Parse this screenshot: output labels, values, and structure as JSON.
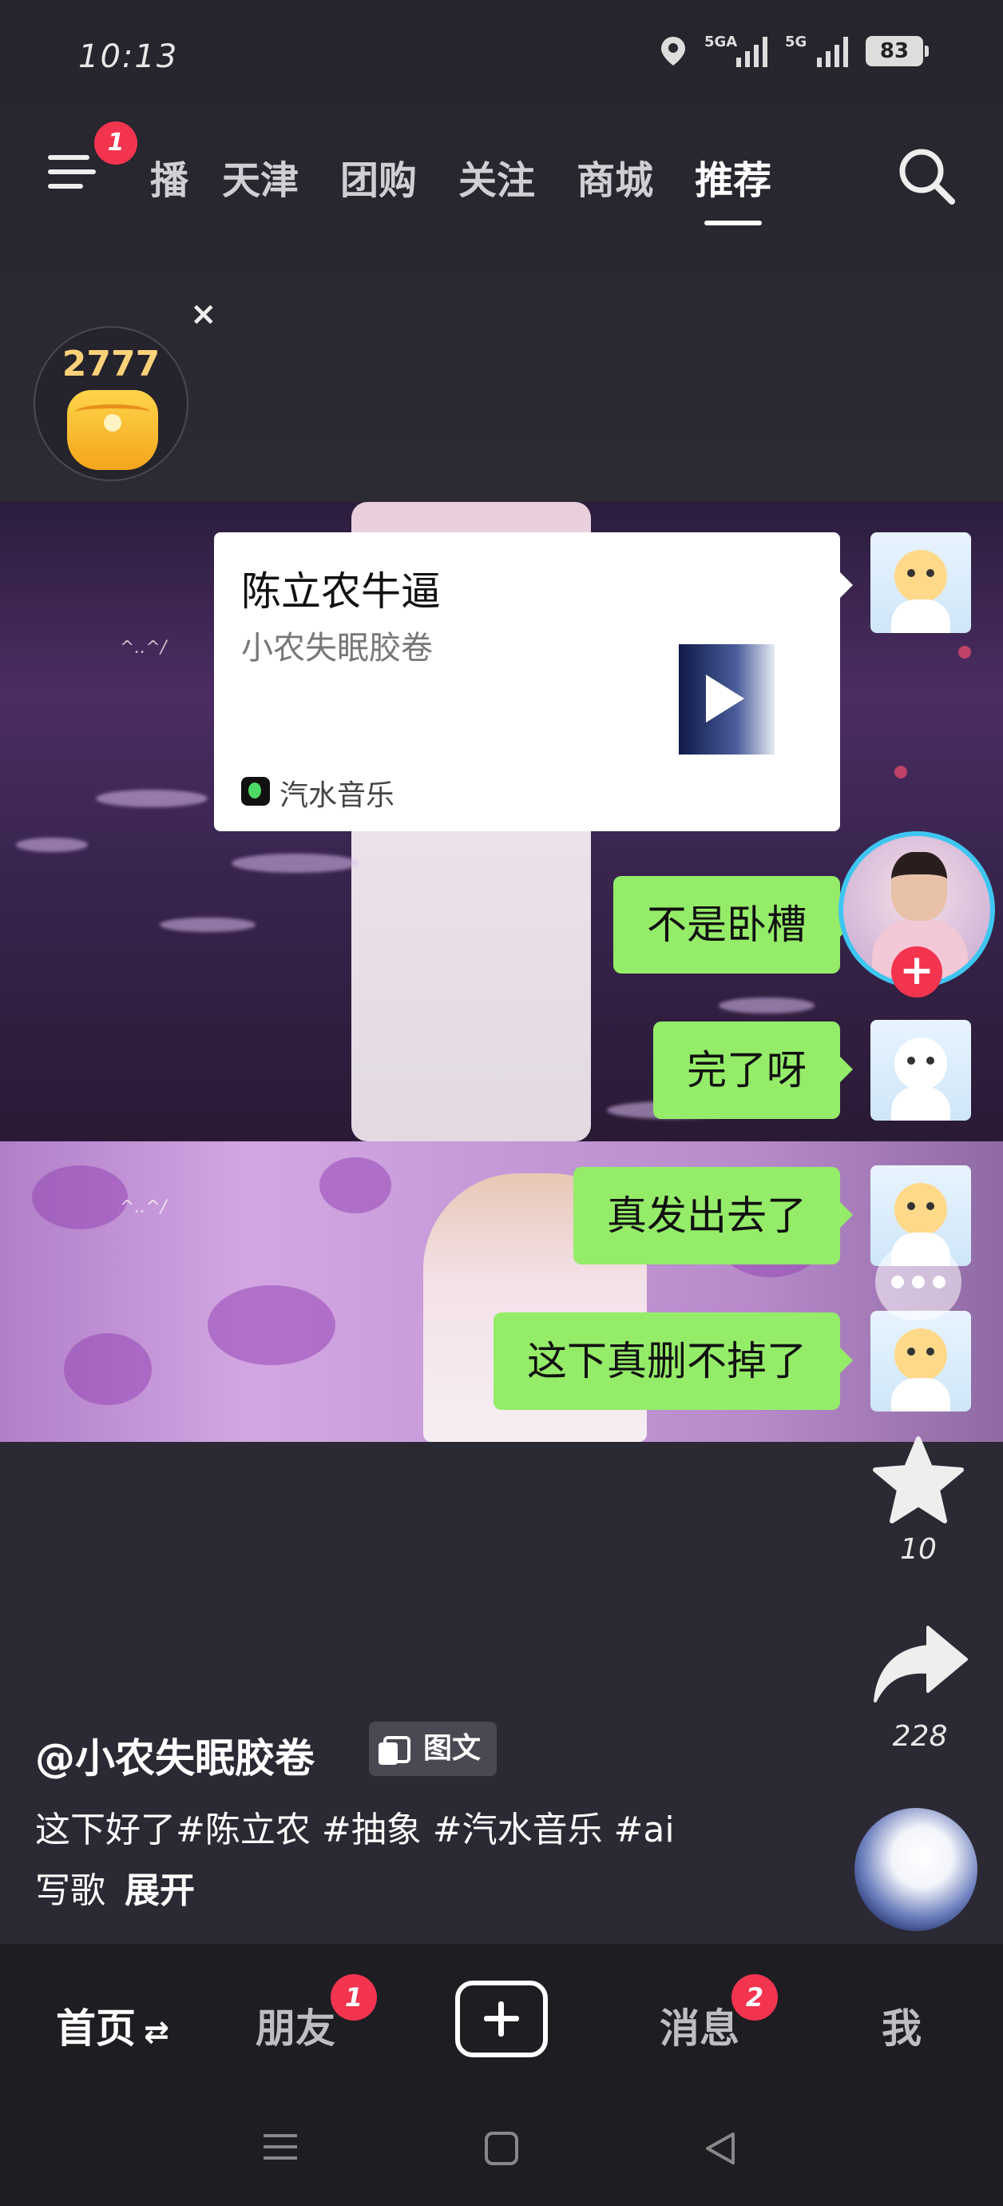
{
  "status_bar": {
    "time": "10:13",
    "signal_1_label": "5GA",
    "signal_2_label": "5G",
    "battery": "83"
  },
  "top_nav": {
    "menu_badge": "1",
    "tabs": [
      {
        "label": "播"
      },
      {
        "label": "天津"
      },
      {
        "label": "团购"
      },
      {
        "label": "关注"
      },
      {
        "label": "商城"
      },
      {
        "label": "推荐"
      }
    ],
    "active_tab": "推荐"
  },
  "coin_widget": {
    "amount": "2777",
    "close_symbol": "×"
  },
  "music_card": {
    "title": "陈立农牛逼",
    "artist": "小农失眠胶卷",
    "app_name": "汽水音乐"
  },
  "chat": {
    "messages": [
      {
        "text": "不是卧槽"
      },
      {
        "text": "完了呀"
      },
      {
        "text": "真发出去了"
      },
      {
        "text": "这下真删不掉了"
      }
    ]
  },
  "right_rail": {
    "favorite_count": "10",
    "share_count": "228"
  },
  "post": {
    "author": "@小农失眠胶卷",
    "type_tag": "图文",
    "caption_line1": "这下好了#陈立农 #抽象 #汽水音乐 #ai",
    "caption_line2": "写歌",
    "expand_label": "展开"
  },
  "bottom_tabs": {
    "home": "首页",
    "home_swap": "⇄",
    "friends": "朋友",
    "friends_badge": "1",
    "messages": "消息",
    "messages_badge": "2",
    "me": "我"
  },
  "colors": {
    "accent_red": "#f2344f",
    "chat_green": "#95ec69",
    "avatar_ring": "#3ec6f0",
    "background": "#2b2933"
  },
  "icons": [
    "menu-icon",
    "search-icon",
    "location-icon",
    "star-icon",
    "share-icon",
    "plus-icon",
    "play-icon",
    "music-app-icon"
  ]
}
